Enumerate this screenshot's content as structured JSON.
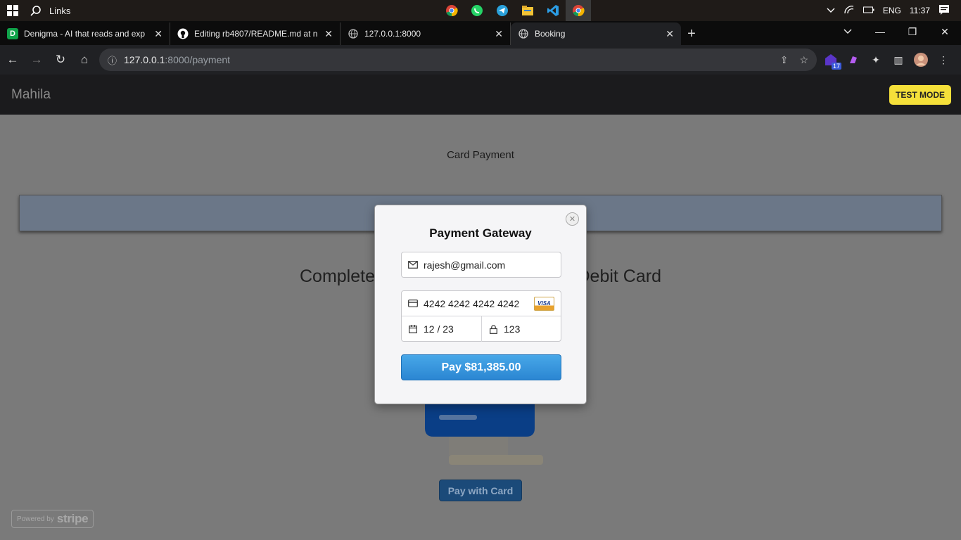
{
  "taskbar": {
    "search_label": "Links",
    "apps": [
      "chrome-icon",
      "whatsapp-icon",
      "telegram-icon",
      "file-explorer-icon",
      "vscode-icon",
      "chrome-icon"
    ],
    "language": "ENG",
    "time": "11:37"
  },
  "browser": {
    "tabs": [
      {
        "title": "Denigma - AI that reads and exp",
        "favicon": "D",
        "favicon_color": "#1db954"
      },
      {
        "title": "Editing rb4807/README.md at n",
        "favicon": "github-icon"
      },
      {
        "title": "127.0.0.1:8000",
        "favicon": "globe-icon"
      },
      {
        "title": "Booking",
        "favicon": "globe-icon",
        "active": true
      }
    ],
    "url_host": "127.0.0.1",
    "url_path": ":8000/payment",
    "extension_badge": "17"
  },
  "page": {
    "brand": "Mahila",
    "test_mode": "TEST MODE",
    "heading": "Card Payment",
    "complete_left": "Complete",
    "complete_right": "Debit Card",
    "pay_with_card": "Pay with Card",
    "powered_by": "Powered by",
    "stripe": "stripe"
  },
  "modal": {
    "title": "Payment Gateway",
    "email": "rajesh@gmail.com",
    "card_number": "4242 4242 4242 4242",
    "card_brand": "VISA",
    "expiry": "12 / 23",
    "cvc": "123",
    "pay_button": "Pay $81,385.00",
    "close_symbol": "✕"
  },
  "colors": {
    "pay_button": "#2b86d2",
    "test_mode": "#f5e03a",
    "overlay": "#7a7a7a"
  }
}
